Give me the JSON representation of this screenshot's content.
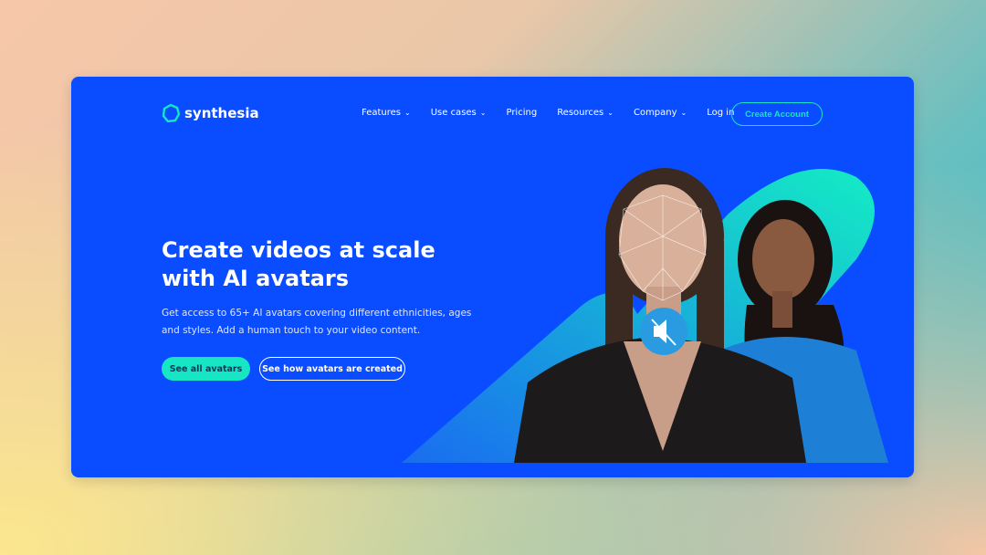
{
  "brand": {
    "name": "synthesia"
  },
  "nav": {
    "items": [
      {
        "label": "Features",
        "dropdown": true
      },
      {
        "label": "Use cases",
        "dropdown": true
      },
      {
        "label": "Pricing",
        "dropdown": false
      },
      {
        "label": "Resources",
        "dropdown": true
      },
      {
        "label": "Company",
        "dropdown": true
      },
      {
        "label": "Log in",
        "dropdown": false
      }
    ],
    "cta": "Create Account"
  },
  "hero": {
    "title": "Create videos at scale with AI avatars",
    "subtitle": "Get access to 65+ AI avatars covering different ethnicities, ages and styles. Add a human touch to your video content.",
    "primary_button": "See all avatars",
    "secondary_button": "See how avatars are created",
    "mute_icon": "speaker-muted-icon"
  },
  "colors": {
    "brand_blue": "#0a4cff",
    "accent": "#16e6c3"
  }
}
